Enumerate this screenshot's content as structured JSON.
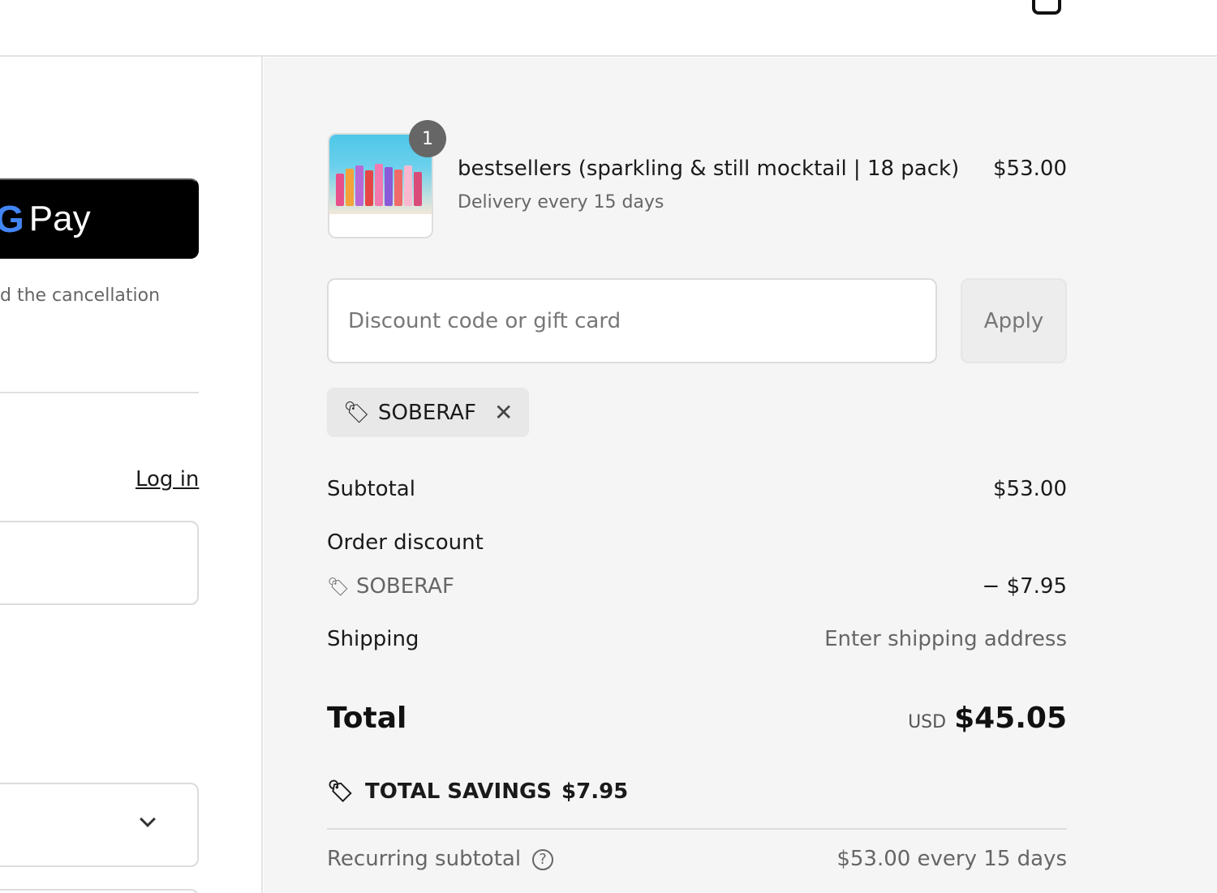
{
  "header": {
    "cart_icon": "shopping-bag-icon"
  },
  "express": {
    "gpay_g": "G",
    "gpay_label": "Pay",
    "cancellation_text": "d the cancellation"
  },
  "contact": {
    "login_label": "Log in"
  },
  "cart": {
    "item": {
      "quantity": "1",
      "title": "bestsellers (sparkling & still mocktail | 18 pack)",
      "subtitle": "Delivery every 15 days",
      "price": "$53.00"
    },
    "discount": {
      "placeholder": "Discount code or gift card",
      "apply_label": "Apply",
      "applied_code": "SOBERAF",
      "tag_icon": "tag-icon",
      "remove_icon": "close-icon"
    },
    "summary": {
      "subtotal_label": "Subtotal",
      "subtotal_value": "$53.00",
      "order_discount_label": "Order discount",
      "discount_code": "SOBERAF",
      "discount_value": "− $7.95",
      "shipping_label": "Shipping",
      "shipping_value": "Enter shipping address",
      "total_label": "Total",
      "total_currency": "USD",
      "total_value": "$45.05",
      "savings_label": "TOTAL SAVINGS",
      "savings_value": "$7.95",
      "recurring_label": "Recurring subtotal",
      "recurring_value": "$53.00 every 15 days"
    }
  },
  "colors": {
    "summary_bg": "#f5f5f5",
    "gpay_bg": "#000000",
    "badge_bg": "#666666"
  }
}
